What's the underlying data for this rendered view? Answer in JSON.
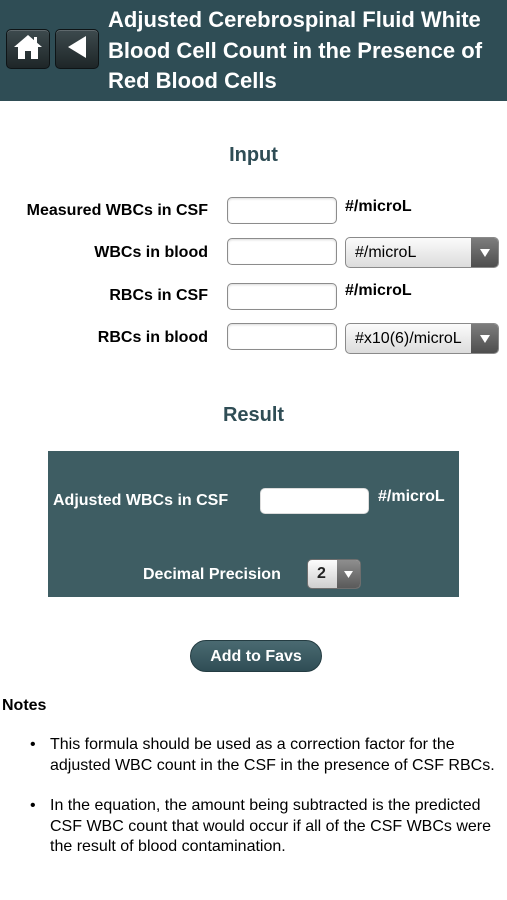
{
  "header": {
    "title": "Adjusted Cerebrospinal Fluid White Blood Cell Count in the Presence of Red Blood Cells",
    "home_icon": "home-icon",
    "back_icon": "back-arrow-icon"
  },
  "input": {
    "title": "Input",
    "rows": [
      {
        "label": "Measured WBCs in CSF",
        "value": "",
        "unit": "#/microL"
      },
      {
        "label": "WBCs in blood",
        "value": "",
        "unit_select": "#/microL"
      },
      {
        "label": "RBCs in CSF",
        "value": "",
        "unit": "#/microL"
      },
      {
        "label": "RBCs in blood",
        "value": "",
        "unit_select": "#x10(6)/microL"
      }
    ]
  },
  "result": {
    "title": "Result",
    "label": "Adjusted WBCs in CSF",
    "value": "",
    "unit": "#/microL",
    "precision_label": "Decimal Precision",
    "precision_value": "2"
  },
  "actions": {
    "add_to_favs": "Add to Favs"
  },
  "notes": {
    "title": "Notes",
    "items": [
      "This formula should be used as a correction factor for the adjusted WBC count in the CSF in the presence of CSF RBCs.",
      "In the equation, the amount being subtracted is the predicted CSF WBC count that would occur if all of the CSF WBCs were the result of blood contamination."
    ]
  },
  "colors": {
    "header_bg": "#2f4d55",
    "accent": "#2f4d55",
    "result_bg": "#3e5d63"
  }
}
